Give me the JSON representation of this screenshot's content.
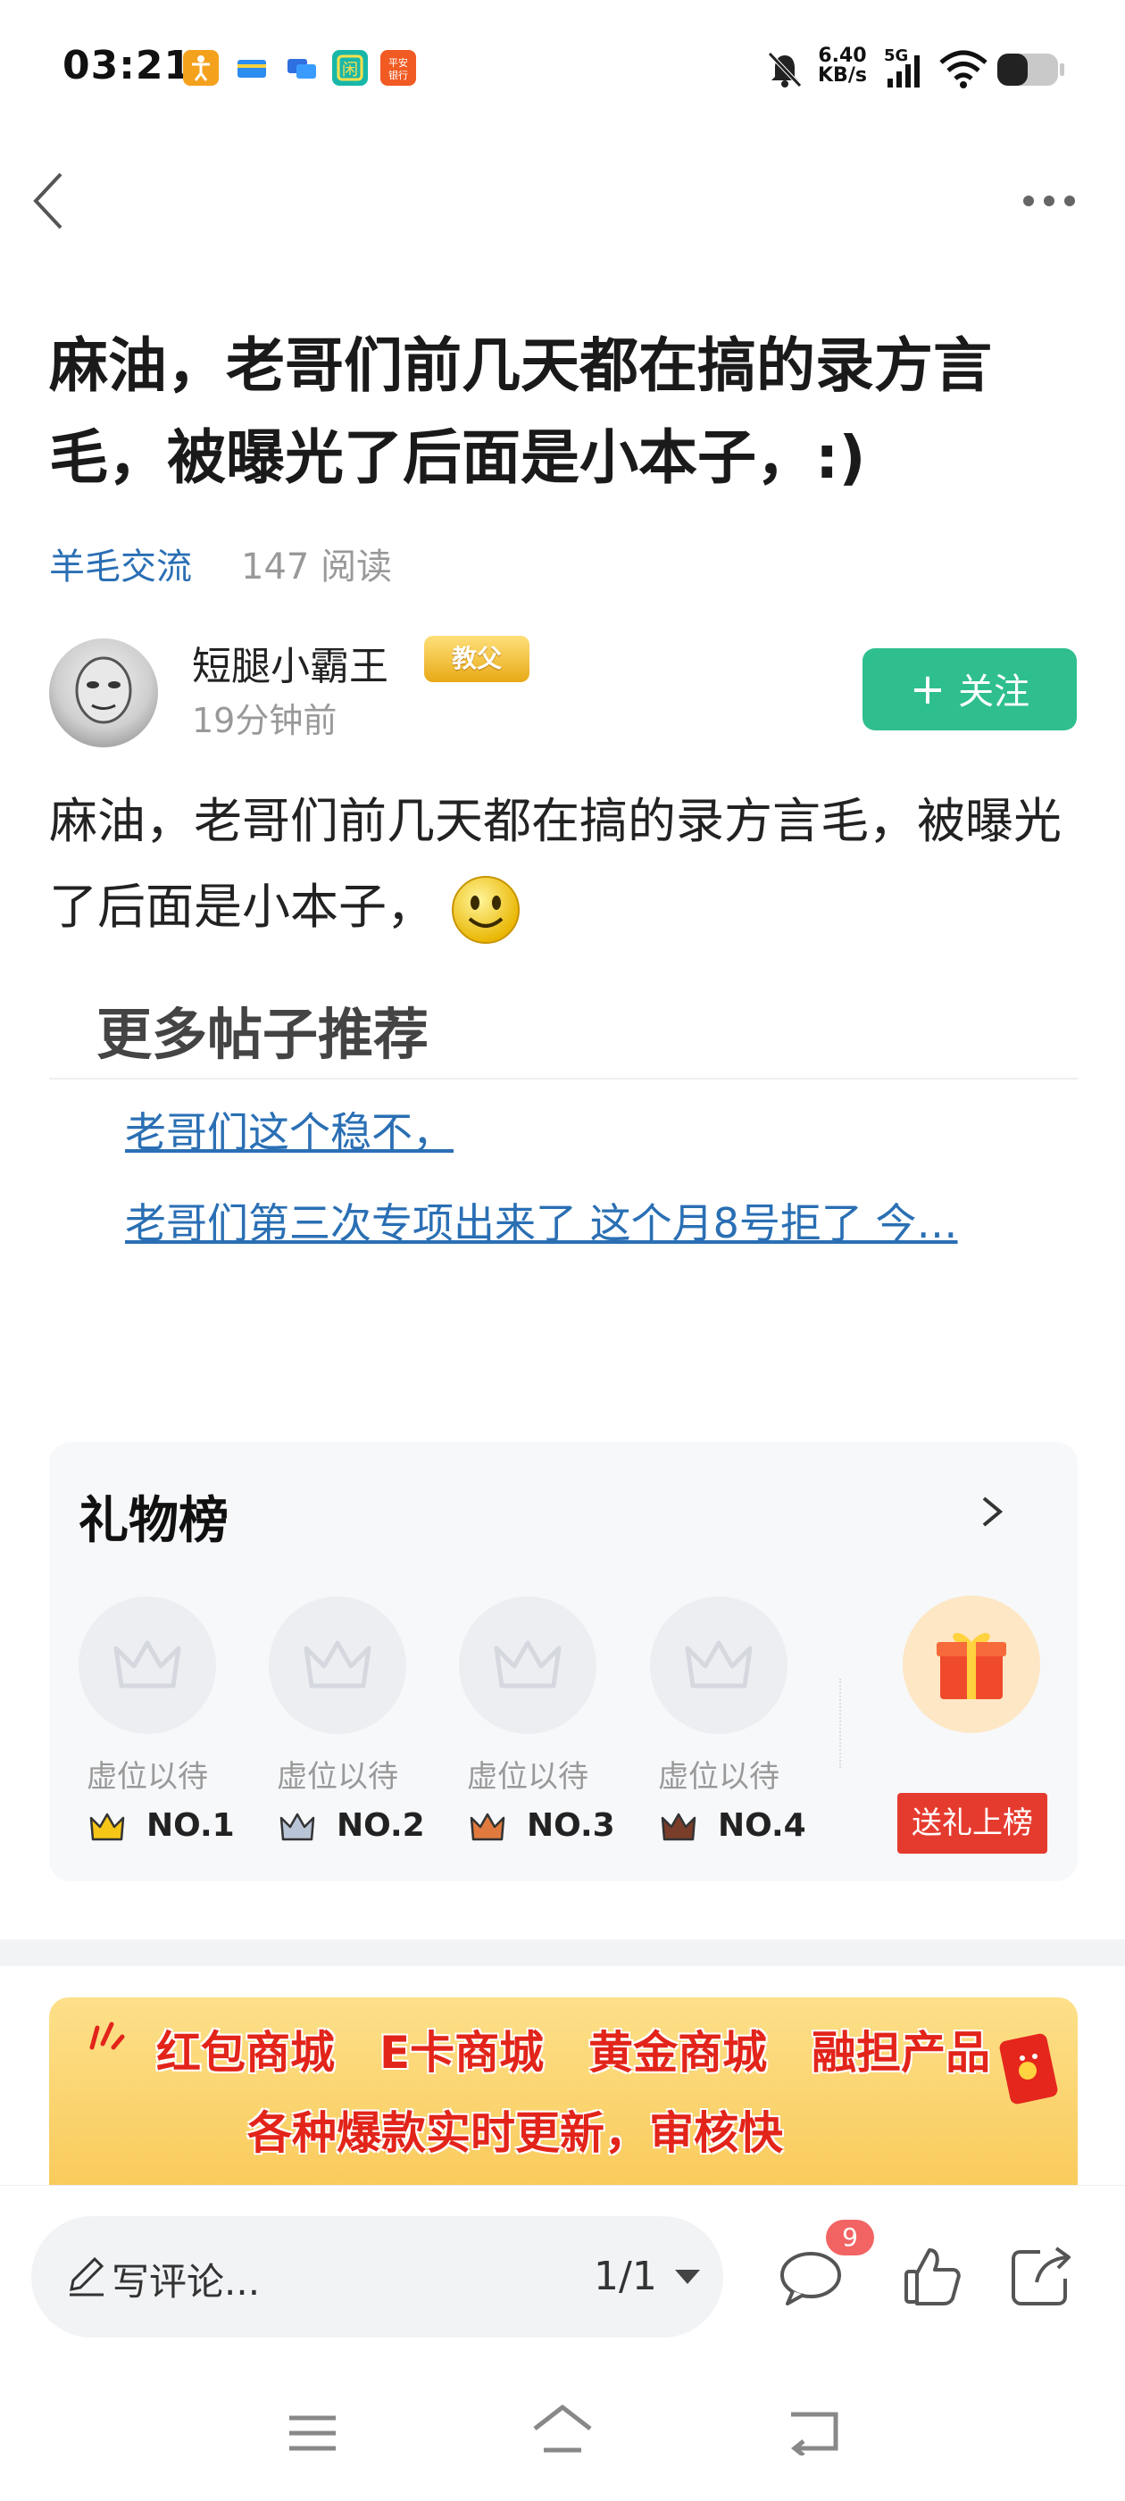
{
  "status_bar": {
    "time": "03:21",
    "net_speed_value": "6.40",
    "net_speed_unit": "KB/s",
    "network": "5G",
    "icons": [
      "accessibility-icon",
      "card-icon",
      "chat-app-icon",
      "xianyu-app-icon",
      "pingan-bank-icon",
      "mute-bell-icon",
      "signal-icon",
      "wifi-icon",
      "battery-icon"
    ]
  },
  "nav": {
    "back_icon": "chevron-left-icon",
    "more_icon": "more-dots-icon"
  },
  "post": {
    "title": "麻油，老哥们前几天都在搞的录方言毛，被曝光了后面是小本子，:)",
    "category": "羊毛交流",
    "read_count": "147 阅读",
    "author": {
      "name": "短腿小霸王",
      "badge": "教父",
      "time": "19分钟前"
    },
    "follow_label": "关注",
    "body": "麻油，老哥们前几天都在搞的录方言毛，被曝光了后面是小本子，"
  },
  "more_posts": {
    "heading": "更多帖子推荐",
    "items": [
      "老哥们这个稳不，",
      "老哥们第三次专项出来了 这个月8号拒了 今…"
    ]
  },
  "gift_rank": {
    "title": "礼物榜",
    "slots": [
      {
        "label": "虚位以待",
        "rank": "NO.1",
        "crown_color": "#f5c518"
      },
      {
        "label": "虚位以待",
        "rank": "NO.2",
        "crown_color": "#b9c4d6"
      },
      {
        "label": "虚位以待",
        "rank": "NO.3",
        "crown_color": "#e07a3e"
      },
      {
        "label": "虚位以待",
        "rank": "NO.4",
        "crown_color": "#7a3d2a"
      }
    ],
    "send_label": "送礼上榜"
  },
  "banner": {
    "line1": "红包商城　E卡商城　黄金商城　融担产品",
    "line2": "各种爆款实时更新，审核快"
  },
  "bottom_bar": {
    "comment_placeholder": "写评论...",
    "page": "1/1",
    "comment_count": "9"
  },
  "colors": {
    "accent": "#2fbf8f",
    "link": "#2a6fb4",
    "badge_red": "#f26464",
    "gift_red": "#e53b2f"
  }
}
